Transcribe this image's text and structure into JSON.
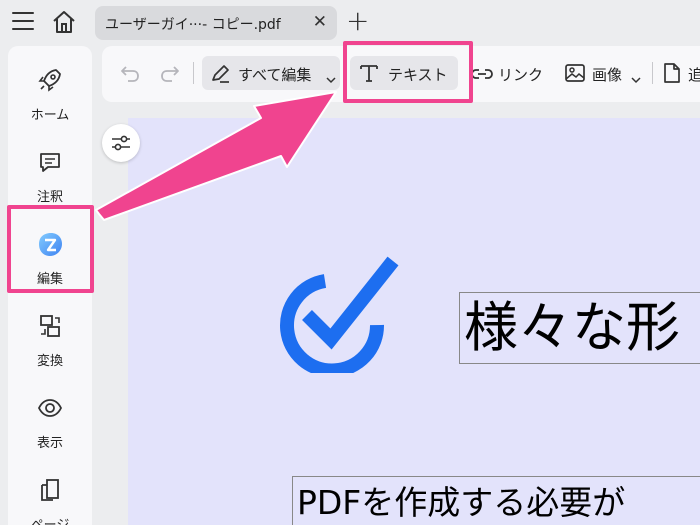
{
  "tab": {
    "title": "ユーザーガイ···- コピー.pdf"
  },
  "sidebar": {
    "items": [
      {
        "label": "ホーム",
        "icon": "rocket-icon"
      },
      {
        "label": "注釈",
        "icon": "comment-icon"
      },
      {
        "label": "編集",
        "icon": "edit-logo-icon"
      },
      {
        "label": "変換",
        "icon": "convert-icon"
      },
      {
        "label": "表示",
        "icon": "eye-icon"
      },
      {
        "label": "ページ",
        "icon": "page-icon"
      }
    ]
  },
  "toolbar": {
    "edit_all_label": "すべて編集",
    "text_label": "テキスト",
    "link_label": "リンク",
    "image_label": "画像",
    "more_label": "追"
  },
  "document": {
    "heading": "様々な形",
    "body": "PDFを作成する必要が"
  },
  "colors": {
    "highlight": "#f0448f",
    "accent_blue": "#1d6ef0",
    "page_bg": "#e3e3fb"
  }
}
